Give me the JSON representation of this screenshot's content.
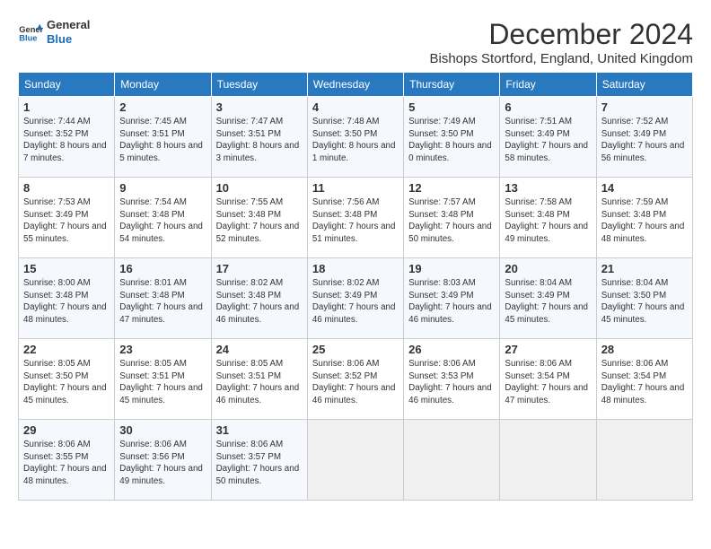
{
  "header": {
    "logo_general": "General",
    "logo_blue": "Blue",
    "title": "December 2024",
    "subtitle": "Bishops Stortford, England, United Kingdom"
  },
  "weekdays": [
    "Sunday",
    "Monday",
    "Tuesday",
    "Wednesday",
    "Thursday",
    "Friday",
    "Saturday"
  ],
  "weeks": [
    [
      {
        "day": "1",
        "sunrise": "7:44 AM",
        "sunset": "3:52 PM",
        "daylight": "8 hours and 7 minutes."
      },
      {
        "day": "2",
        "sunrise": "7:45 AM",
        "sunset": "3:51 PM",
        "daylight": "8 hours and 5 minutes."
      },
      {
        "day": "3",
        "sunrise": "7:47 AM",
        "sunset": "3:51 PM",
        "daylight": "8 hours and 3 minutes."
      },
      {
        "day": "4",
        "sunrise": "7:48 AM",
        "sunset": "3:50 PM",
        "daylight": "8 hours and 1 minute."
      },
      {
        "day": "5",
        "sunrise": "7:49 AM",
        "sunset": "3:50 PM",
        "daylight": "8 hours and 0 minutes."
      },
      {
        "day": "6",
        "sunrise": "7:51 AM",
        "sunset": "3:49 PM",
        "daylight": "7 hours and 58 minutes."
      },
      {
        "day": "7",
        "sunrise": "7:52 AM",
        "sunset": "3:49 PM",
        "daylight": "7 hours and 56 minutes."
      }
    ],
    [
      {
        "day": "8",
        "sunrise": "7:53 AM",
        "sunset": "3:49 PM",
        "daylight": "7 hours and 55 minutes."
      },
      {
        "day": "9",
        "sunrise": "7:54 AM",
        "sunset": "3:48 PM",
        "daylight": "7 hours and 54 minutes."
      },
      {
        "day": "10",
        "sunrise": "7:55 AM",
        "sunset": "3:48 PM",
        "daylight": "7 hours and 52 minutes."
      },
      {
        "day": "11",
        "sunrise": "7:56 AM",
        "sunset": "3:48 PM",
        "daylight": "7 hours and 51 minutes."
      },
      {
        "day": "12",
        "sunrise": "7:57 AM",
        "sunset": "3:48 PM",
        "daylight": "7 hours and 50 minutes."
      },
      {
        "day": "13",
        "sunrise": "7:58 AM",
        "sunset": "3:48 PM",
        "daylight": "7 hours and 49 minutes."
      },
      {
        "day": "14",
        "sunrise": "7:59 AM",
        "sunset": "3:48 PM",
        "daylight": "7 hours and 48 minutes."
      }
    ],
    [
      {
        "day": "15",
        "sunrise": "8:00 AM",
        "sunset": "3:48 PM",
        "daylight": "7 hours and 48 minutes."
      },
      {
        "day": "16",
        "sunrise": "8:01 AM",
        "sunset": "3:48 PM",
        "daylight": "7 hours and 47 minutes."
      },
      {
        "day": "17",
        "sunrise": "8:02 AM",
        "sunset": "3:48 PM",
        "daylight": "7 hours and 46 minutes."
      },
      {
        "day": "18",
        "sunrise": "8:02 AM",
        "sunset": "3:49 PM",
        "daylight": "7 hours and 46 minutes."
      },
      {
        "day": "19",
        "sunrise": "8:03 AM",
        "sunset": "3:49 PM",
        "daylight": "7 hours and 46 minutes."
      },
      {
        "day": "20",
        "sunrise": "8:04 AM",
        "sunset": "3:49 PM",
        "daylight": "7 hours and 45 minutes."
      },
      {
        "day": "21",
        "sunrise": "8:04 AM",
        "sunset": "3:50 PM",
        "daylight": "7 hours and 45 minutes."
      }
    ],
    [
      {
        "day": "22",
        "sunrise": "8:05 AM",
        "sunset": "3:50 PM",
        "daylight": "7 hours and 45 minutes."
      },
      {
        "day": "23",
        "sunrise": "8:05 AM",
        "sunset": "3:51 PM",
        "daylight": "7 hours and 45 minutes."
      },
      {
        "day": "24",
        "sunrise": "8:05 AM",
        "sunset": "3:51 PM",
        "daylight": "7 hours and 46 minutes."
      },
      {
        "day": "25",
        "sunrise": "8:06 AM",
        "sunset": "3:52 PM",
        "daylight": "7 hours and 46 minutes."
      },
      {
        "day": "26",
        "sunrise": "8:06 AM",
        "sunset": "3:53 PM",
        "daylight": "7 hours and 46 minutes."
      },
      {
        "day": "27",
        "sunrise": "8:06 AM",
        "sunset": "3:54 PM",
        "daylight": "7 hours and 47 minutes."
      },
      {
        "day": "28",
        "sunrise": "8:06 AM",
        "sunset": "3:54 PM",
        "daylight": "7 hours and 48 minutes."
      }
    ],
    [
      {
        "day": "29",
        "sunrise": "8:06 AM",
        "sunset": "3:55 PM",
        "daylight": "7 hours and 48 minutes."
      },
      {
        "day": "30",
        "sunrise": "8:06 AM",
        "sunset": "3:56 PM",
        "daylight": "7 hours and 49 minutes."
      },
      {
        "day": "31",
        "sunrise": "8:06 AM",
        "sunset": "3:57 PM",
        "daylight": "7 hours and 50 minutes."
      },
      null,
      null,
      null,
      null
    ]
  ],
  "labels": {
    "sunrise": "Sunrise:",
    "sunset": "Sunset:",
    "daylight": "Daylight:"
  }
}
